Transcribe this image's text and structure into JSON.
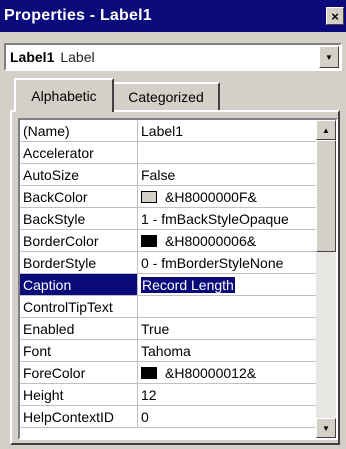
{
  "window": {
    "title": "Properties - Label1",
    "close_glyph": "×"
  },
  "object_selector": {
    "name": "Label1",
    "type": "Label",
    "dropdown_icon": "chevron-down-icon"
  },
  "tabs": [
    {
      "label": "Alphabetic",
      "active": true
    },
    {
      "label": "Categorized",
      "active": false
    }
  ],
  "properties": [
    {
      "name": "(Name)",
      "value": "Label1"
    },
    {
      "name": "Accelerator",
      "value": ""
    },
    {
      "name": "AutoSize",
      "value": "False"
    },
    {
      "name": "BackColor",
      "value": "&H8000000F&",
      "swatch": "#d4d0c8"
    },
    {
      "name": "BackStyle",
      "value": "1 - fmBackStyleOpaque"
    },
    {
      "name": "BorderColor",
      "value": "&H80000006&",
      "swatch": "#000000"
    },
    {
      "name": "BorderStyle",
      "value": "0 - fmBorderStyleNone"
    },
    {
      "name": "Caption",
      "value": "Record Length",
      "selected": true
    },
    {
      "name": "ControlTipText",
      "value": ""
    },
    {
      "name": "Enabled",
      "value": "True"
    },
    {
      "name": "Font",
      "value": "Tahoma"
    },
    {
      "name": "ForeColor",
      "value": "&H80000012&",
      "swatch": "#000000"
    },
    {
      "name": "Height",
      "value": "12"
    },
    {
      "name": "HelpContextID",
      "value": "0"
    }
  ],
  "scrollbar": {
    "position": 0.0
  },
  "colors": {
    "title_bar": "#0a0a7a",
    "selection": "#0a0a7a",
    "face": "#d4d0c8"
  }
}
